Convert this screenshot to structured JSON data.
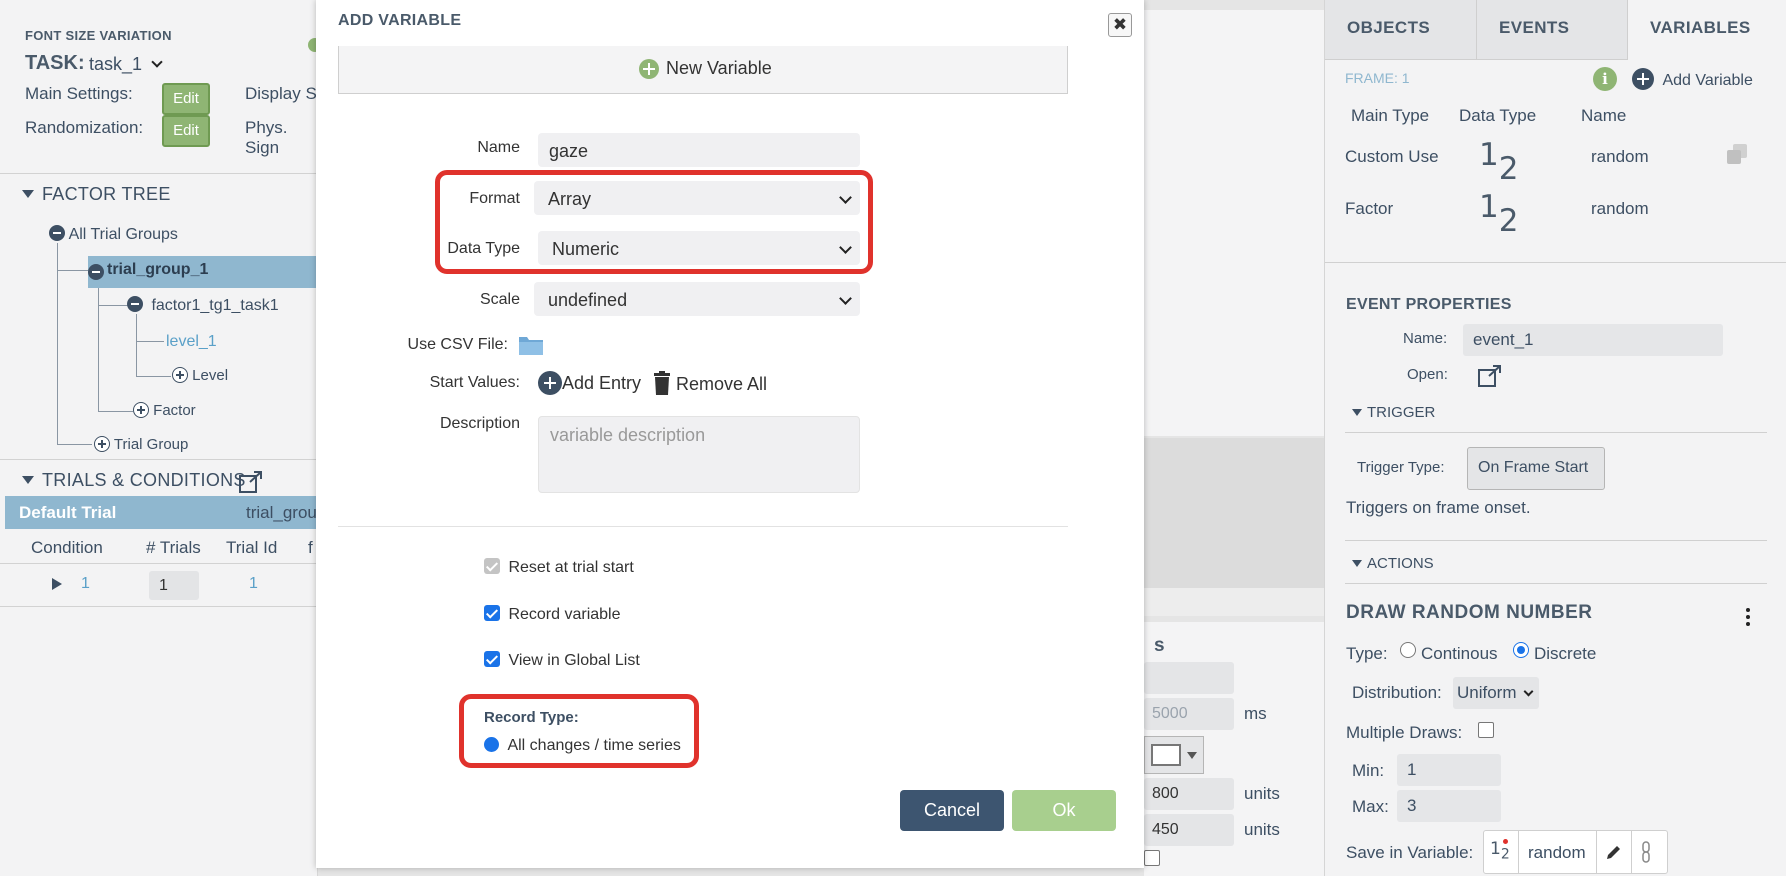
{
  "left": {
    "subtitle": "FONT SIZE VARIATION",
    "task_label": "TASK:",
    "task_value": "task_1",
    "main_settings_label": "Main Settings:",
    "randomization_label": "Randomization:",
    "edit_label": "Edit",
    "display_partial": "Display S",
    "phys_partial": "Phys. Sign",
    "factor_tree_title": "FACTOR TREE",
    "tree": {
      "all_trial_groups": "All Trial Groups",
      "trial_group_1": "trial_group_1",
      "factor": "factor1_tg1_task1",
      "level_1": "level_1",
      "add_level": "Level",
      "add_factor": "Factor",
      "add_trial_group": "Trial Group"
    },
    "trials_title": "TRIALS & CONDITIONS",
    "default_trial": "Default Trial",
    "default_trial_group": "trial_grou",
    "columns": [
      "Condition",
      "# Trials",
      "Trial Id",
      "f"
    ],
    "row": {
      "condition": "1",
      "trials": "1",
      "trial_id": "1"
    }
  },
  "modal": {
    "title": "ADD VARIABLE",
    "new_variable": "New Variable",
    "name_label": "Name",
    "name_value": "gaze",
    "format_label": "Format",
    "format_value": "Array",
    "data_type_label": "Data Type",
    "data_type_value": "Numeric",
    "scale_label": "Scale",
    "scale_value": "undefined",
    "csv_label": "Use CSV File:",
    "start_values_label": "Start Values:",
    "add_entry": "Add Entry",
    "remove_all": "Remove All",
    "description_label": "Description",
    "description_placeholder": "variable description",
    "reset_label": "Reset at trial start",
    "record_label": "Record variable",
    "view_label": "View in Global List",
    "record_type_label": "Record Type:",
    "record_type_value": "All changes / time series",
    "cancel": "Cancel",
    "ok": "Ok"
  },
  "behind": {
    "value_5000": "5000",
    "ms": "ms",
    "value_800": "800",
    "value_450": "450",
    "units": "units",
    "partial_s": "s"
  },
  "right": {
    "tabs": [
      "OBJECTS",
      "EVENTS",
      "VARIABLES"
    ],
    "frame_label": "FRAME: 1",
    "add_variable": "Add Variable",
    "col_main_type": "Main Type",
    "col_data_type": "Data Type",
    "col_name": "Name",
    "rows": [
      {
        "main_type": "Custom Use",
        "digit_a": "1",
        "digit_b": "2",
        "name": "random"
      },
      {
        "main_type": "Factor",
        "digit_a": "1",
        "digit_b": "2",
        "name": "random"
      }
    ],
    "event_properties": "EVENT PROPERTIES",
    "name_label": "Name:",
    "name_value": "event_1",
    "open_label": "Open:",
    "trigger": "TRIGGER",
    "trigger_type_label": "Trigger Type:",
    "trigger_type_value": "On Frame Start",
    "trigger_desc": "Triggers on frame onset.",
    "actions": "ACTIONS",
    "action_title": "DRAW RANDOM NUMBER",
    "type_label": "Type:",
    "type_continous": "Continous",
    "type_discrete": "Discrete",
    "distribution_label": "Distribution:",
    "distribution_value": "Uniform",
    "multiple_draws_label": "Multiple Draws:",
    "min_label": "Min:",
    "min_value": "1",
    "max_label": "Max:",
    "max_value": "3",
    "save_label": "Save in Variable:",
    "save_var": "random"
  }
}
